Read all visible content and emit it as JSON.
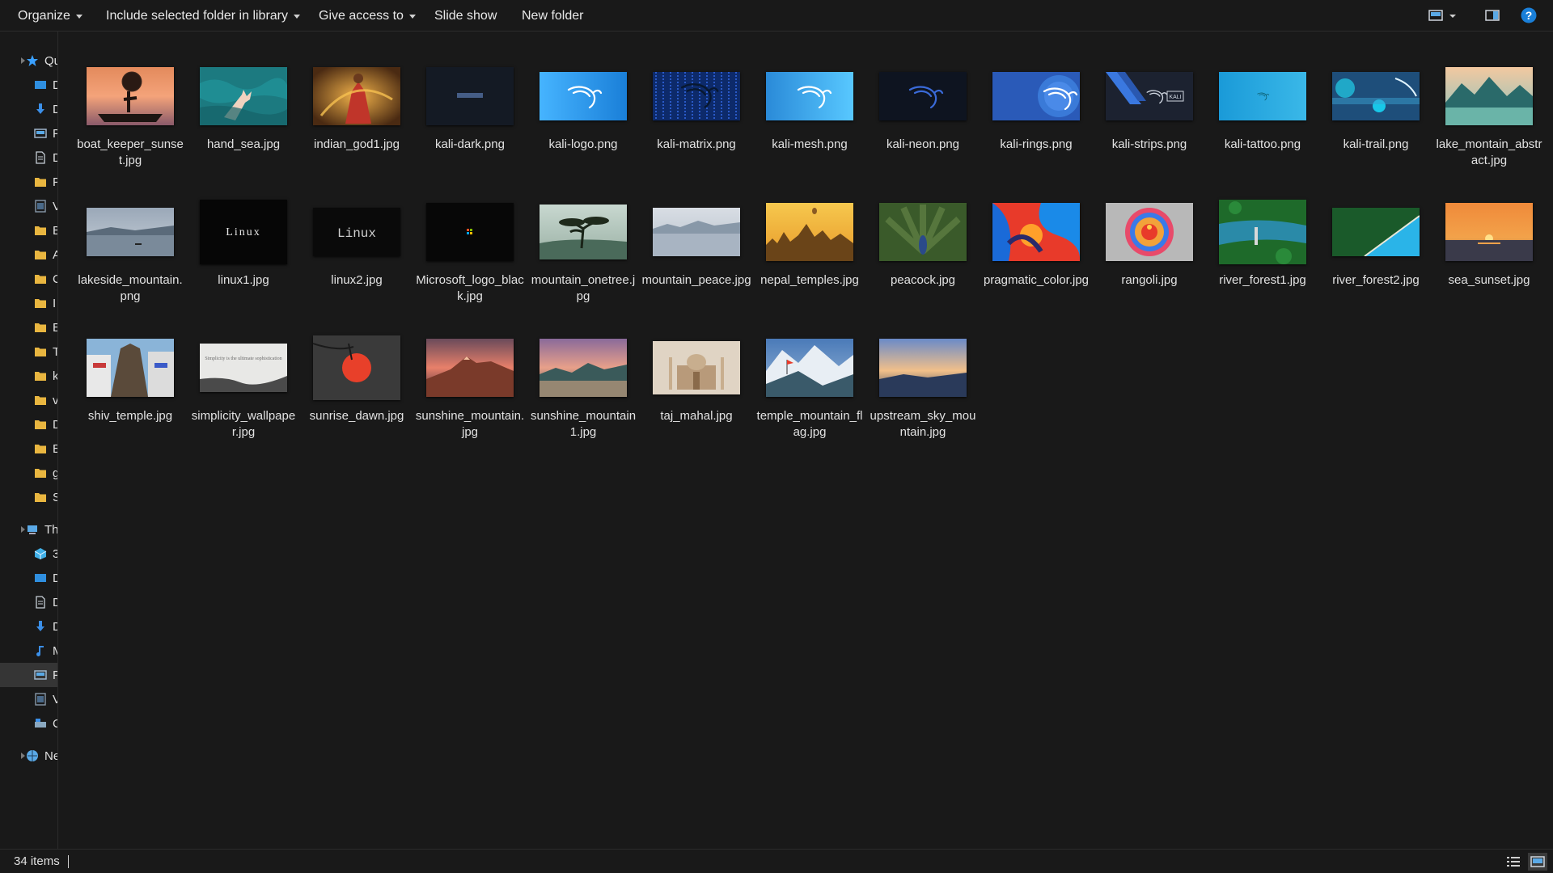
{
  "toolbar": {
    "organize": "Organize",
    "include": "Include selected folder in library",
    "give_access": "Give access to",
    "slide_show": "Slide show",
    "new_folder": "New folder",
    "help": "?"
  },
  "nav": {
    "items": [
      {
        "label": "Qu",
        "icon": "star-icon",
        "color": "#3aa0ff",
        "indent": 0
      },
      {
        "label": "D",
        "icon": "desktop-icon",
        "color": "#2f8fe0",
        "indent": 1
      },
      {
        "label": "D",
        "icon": "download-icon",
        "color": "#3b8fe8",
        "indent": 1
      },
      {
        "label": "P",
        "icon": "pictures-icon",
        "color": "#9fb6cc",
        "indent": 1
      },
      {
        "label": "D",
        "icon": "document-icon",
        "color": "#c8d0d8",
        "indent": 1
      },
      {
        "label": "P",
        "icon": "folder-icon",
        "color": "#e9b640",
        "indent": 1
      },
      {
        "label": "V",
        "icon": "video-icon",
        "color": "#8899aa",
        "indent": 1
      },
      {
        "label": "B",
        "icon": "folder-icon",
        "color": "#e9b640",
        "indent": 1
      },
      {
        "label": "A",
        "icon": "folder-icon",
        "color": "#e9b640",
        "indent": 1
      },
      {
        "label": "C",
        "icon": "folder-icon",
        "color": "#e9b640",
        "indent": 1
      },
      {
        "label": "I",
        "icon": "folder-icon",
        "color": "#e9b640",
        "indent": 1
      },
      {
        "label": "E",
        "icon": "folder-icon",
        "color": "#e9b640",
        "indent": 1
      },
      {
        "label": "T",
        "icon": "folder-icon",
        "color": "#e9b640",
        "indent": 1
      },
      {
        "label": "k",
        "icon": "folder-icon",
        "color": "#e9b640",
        "indent": 1
      },
      {
        "label": "v",
        "icon": "folder-icon",
        "color": "#e9b640",
        "indent": 1
      },
      {
        "label": "D",
        "icon": "folder-icon",
        "color": "#e9b640",
        "indent": 1
      },
      {
        "label": "E",
        "icon": "folder-icon",
        "color": "#e9b640",
        "indent": 1
      },
      {
        "label": "g",
        "icon": "folder-icon",
        "color": "#e9b640",
        "indent": 1
      },
      {
        "label": "S",
        "icon": "folder-icon",
        "color": "#e9b640",
        "indent": 1
      },
      {
        "label": "Th",
        "icon": "computer-icon",
        "color": "#5aa9e6",
        "indent": 0
      },
      {
        "label": "3",
        "icon": "cube-icon",
        "color": "#40b0e8",
        "indent": 1
      },
      {
        "label": "D",
        "icon": "desktop-icon",
        "color": "#2f8fe0",
        "indent": 1
      },
      {
        "label": "D",
        "icon": "document-icon",
        "color": "#c8d0d8",
        "indent": 1
      },
      {
        "label": "D",
        "icon": "download-icon",
        "color": "#3b8fe8",
        "indent": 1
      },
      {
        "label": "M",
        "icon": "music-icon",
        "color": "#3b8fe8",
        "indent": 1
      },
      {
        "label": "P",
        "icon": "pictures-icon",
        "color": "#9fb6cc",
        "indent": 1,
        "selected": true
      },
      {
        "label": "V",
        "icon": "video-icon",
        "color": "#8899aa",
        "indent": 1
      },
      {
        "label": "C",
        "icon": "drive-icon",
        "color": "#8aa8c0",
        "indent": 1
      },
      {
        "label": "Ne",
        "icon": "network-icon",
        "color": "#5aa9e6",
        "indent": 0
      }
    ]
  },
  "files": [
    {
      "name": "boat_keeper_sunset.jpg",
      "thumb": "boat"
    },
    {
      "name": "hand_sea.jpg",
      "thumb": "handsea"
    },
    {
      "name": "indian_god1.jpg",
      "thumb": "god"
    },
    {
      "name": "kali-dark.png",
      "thumb": "kalidark"
    },
    {
      "name": "kali-logo.png",
      "thumb": "kalilogo"
    },
    {
      "name": "kali-matrix.png",
      "thumb": "kalimatrix"
    },
    {
      "name": "kali-mesh.png",
      "thumb": "kalimesh"
    },
    {
      "name": "kali-neon.png",
      "thumb": "kalineon"
    },
    {
      "name": "kali-rings.png",
      "thumb": "kalirings"
    },
    {
      "name": "kali-strips.png",
      "thumb": "kalistrips"
    },
    {
      "name": "kali-tattoo.png",
      "thumb": "kalitattoo"
    },
    {
      "name": "kali-trail.png",
      "thumb": "kalitrail"
    },
    {
      "name": "lake_montain_abstract.jpg",
      "thumb": "lakeabstract"
    },
    {
      "name": "lakeside_mountain.png",
      "thumb": "lakeside"
    },
    {
      "name": "linux1.jpg",
      "thumb": "linux1"
    },
    {
      "name": "linux2.jpg",
      "thumb": "linux2"
    },
    {
      "name": "Microsoft_logo_black.jpg",
      "thumb": "mslogo"
    },
    {
      "name": "mountain_onetree.jpg",
      "thumb": "onetree"
    },
    {
      "name": "mountain_peace.jpg",
      "thumb": "peace"
    },
    {
      "name": "nepal_temples.jpg",
      "thumb": "nepal"
    },
    {
      "name": "peacock.jpg",
      "thumb": "peacock"
    },
    {
      "name": "pragmatic_color.jpg",
      "thumb": "pragmatic"
    },
    {
      "name": "rangoli.jpg",
      "thumb": "rangoli"
    },
    {
      "name": "river_forest1.jpg",
      "thumb": "river1"
    },
    {
      "name": "river_forest2.jpg",
      "thumb": "river2"
    },
    {
      "name": "sea_sunset.jpg",
      "thumb": "seasunset"
    },
    {
      "name": "shiv_temple.jpg",
      "thumb": "shiv"
    },
    {
      "name": "simplicity_wallpaper.jpg",
      "thumb": "simplicity"
    },
    {
      "name": "sunrise_dawn.jpg",
      "thumb": "sunrise"
    },
    {
      "name": "sunshine_mountain.jpg",
      "thumb": "sunshine"
    },
    {
      "name": "sunshine_mountain1.jpg",
      "thumb": "sunshine1"
    },
    {
      "name": "taj_mahal.jpg",
      "thumb": "taj"
    },
    {
      "name": "temple_mountain_flag.jpg",
      "thumb": "templeflag"
    },
    {
      "name": "upstream_sky_mountain.jpg",
      "thumb": "upstream"
    }
  ],
  "thumb_text": {
    "linux1": "Linux",
    "linux2": "Linux",
    "kalistrips": "KALI",
    "simplicity": "Simplicity is the ultimate sophistication"
  },
  "status": {
    "count": "34 items"
  }
}
